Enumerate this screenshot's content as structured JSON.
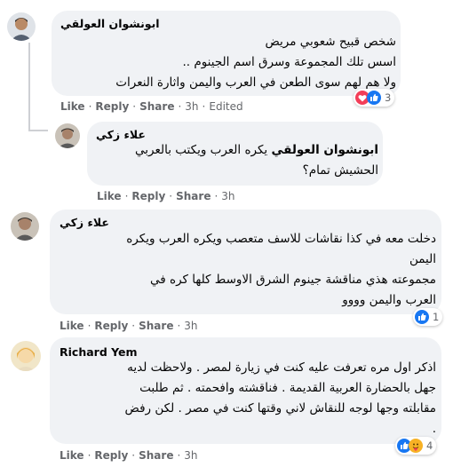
{
  "comments": [
    {
      "author": "ابونشوان العولقي",
      "lines": [
        "شخص قبيح شعوبي مريض",
        "اسس تلك المجموعة وسرق اسم الجينوم ..",
        "ولا هم لهم سوى الطعن في العرب واليمن واثارة النعرات"
      ],
      "actions": {
        "like": "Like",
        "reply": "Reply",
        "share": "Share",
        "time": "3h",
        "edited": "Edited"
      },
      "reaction_count": "3",
      "reaction_icons": [
        "heart-icon",
        "like-icon"
      ]
    },
    {
      "author": "علاء زكي",
      "mention": "ابونشوان العولقي",
      "line1_rest": " يكره العرب ويكتب بالعربي",
      "line2": "الحشيش تمام؟",
      "actions": {
        "like": "Like",
        "reply": "Reply",
        "share": "Share",
        "time": "3h"
      }
    },
    {
      "author": "علاء زكي",
      "lines": [
        "دخلت معه في كذا نقاشات للاسف متعصب ويكره العرب ويكره",
        "اليمن",
        "مجموعته هذي مناقشة جينوم الشرق الاوسط كلها كره في",
        "العرب واليمن وووو"
      ],
      "actions": {
        "like": "Like",
        "reply": "Reply",
        "share": "Share",
        "time": "3h"
      },
      "reaction_count": "1",
      "reaction_icons": [
        "like-icon"
      ]
    },
    {
      "author": "Richard Yem",
      "lines": [
        "اذكر اول مره تعرفت عليه كنت في زيارة لمصر . ولاحظت لديه",
        "جهل بالحضارة العربية القديمة . فناقشته وافحمته . ثم طلبت",
        "مقابلته وجها لوجه للنقاش لاني وقتها كنت في مصر . لكن رفض",
        "."
      ],
      "actions": {
        "like": "Like",
        "reply": "Reply",
        "share": "Share",
        "time": "3h"
      },
      "reaction_count": "4",
      "reaction_icons": [
        "like-icon",
        "care-icon"
      ]
    }
  ],
  "colors": {
    "bubble": "#f0f2f5",
    "meta_text": "#65676b",
    "like_blue": "#1877f2",
    "love_red": "#f33e58",
    "care_yellow": "#f7b125"
  }
}
